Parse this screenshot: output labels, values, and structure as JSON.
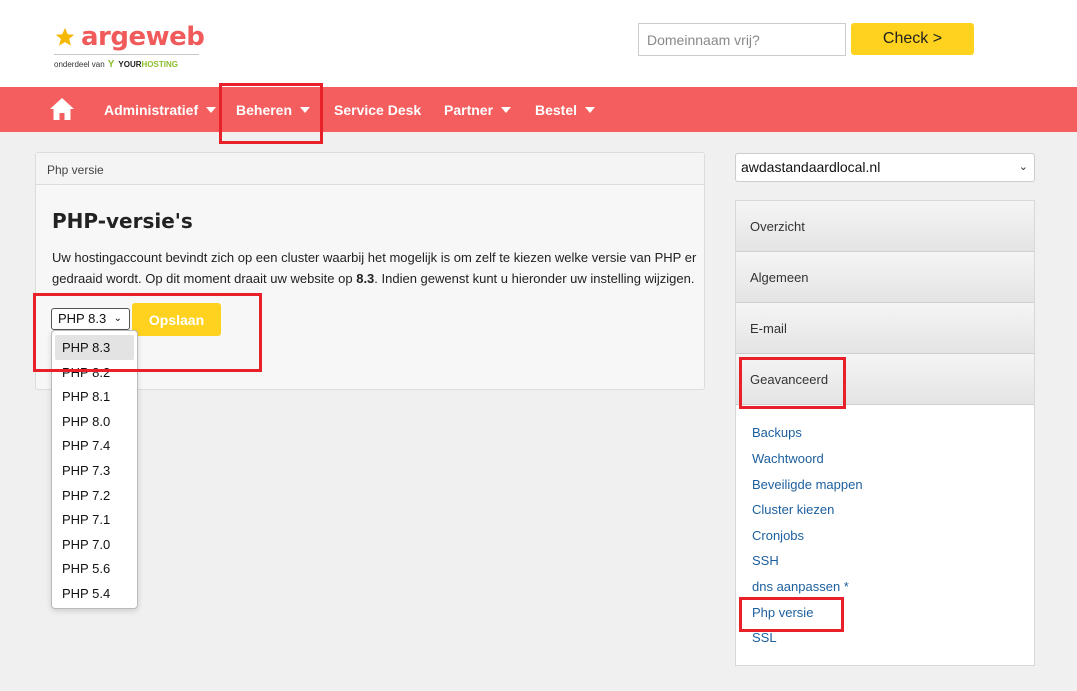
{
  "header": {
    "logo": {
      "name": "argeweb",
      "tagline_prefix": "onderdeel van",
      "partner_mark": "Y",
      "partner_name_a": "YOUR",
      "partner_name_b": "HOSTING"
    },
    "search": {
      "placeholder": "Domeinnaam vrij?",
      "button_label": "Check >"
    }
  },
  "nav": {
    "items": [
      {
        "label": "Administratief",
        "dropdown": true
      },
      {
        "label": "Beheren",
        "dropdown": true
      },
      {
        "label": "Service Desk",
        "dropdown": false
      },
      {
        "label": "Partner",
        "dropdown": true
      },
      {
        "label": "Bestel",
        "dropdown": true
      }
    ]
  },
  "panel": {
    "header": "Php versie",
    "title": "PHP-versie's",
    "text_a": "Uw hostingaccount bevindt zich op een cluster waarbij het mogelijk is om zelf te kiezen welke versie van PHP er gedraaid wordt. Op dit moment draait uw website op ",
    "text_version": "8.3",
    "text_b": ". Indien gewenst kunt u hieronder uw instelling wijzigen.",
    "select_value": "PHP 8.3",
    "save_label": "Opslaan",
    "options": [
      "PHP 8.3",
      "PHP 8.2",
      "PHP 8.1",
      "PHP 8.0",
      "PHP 7.4",
      "PHP 7.3",
      "PHP 7.2",
      "PHP 7.1",
      "PHP 7.0",
      "PHP 5.6",
      "PHP 5.4"
    ]
  },
  "sidebar": {
    "domain": "awdastandaardlocal.nl",
    "sections": [
      "Overzicht",
      "Algemeen",
      "E-mail",
      "Geavanceerd"
    ],
    "links": [
      "Backups",
      "Wachtwoord",
      "Beveiligde mappen",
      "Cluster kiezen",
      "Cronjobs",
      "SSH",
      "dns aanpassen *",
      "Php versie",
      "SSL"
    ]
  },
  "colors": {
    "brand_red": "#f55e5e",
    "accent_yellow": "#ffd21f",
    "link_blue": "#1c5f9e",
    "annotation_red": "#e8202a"
  }
}
